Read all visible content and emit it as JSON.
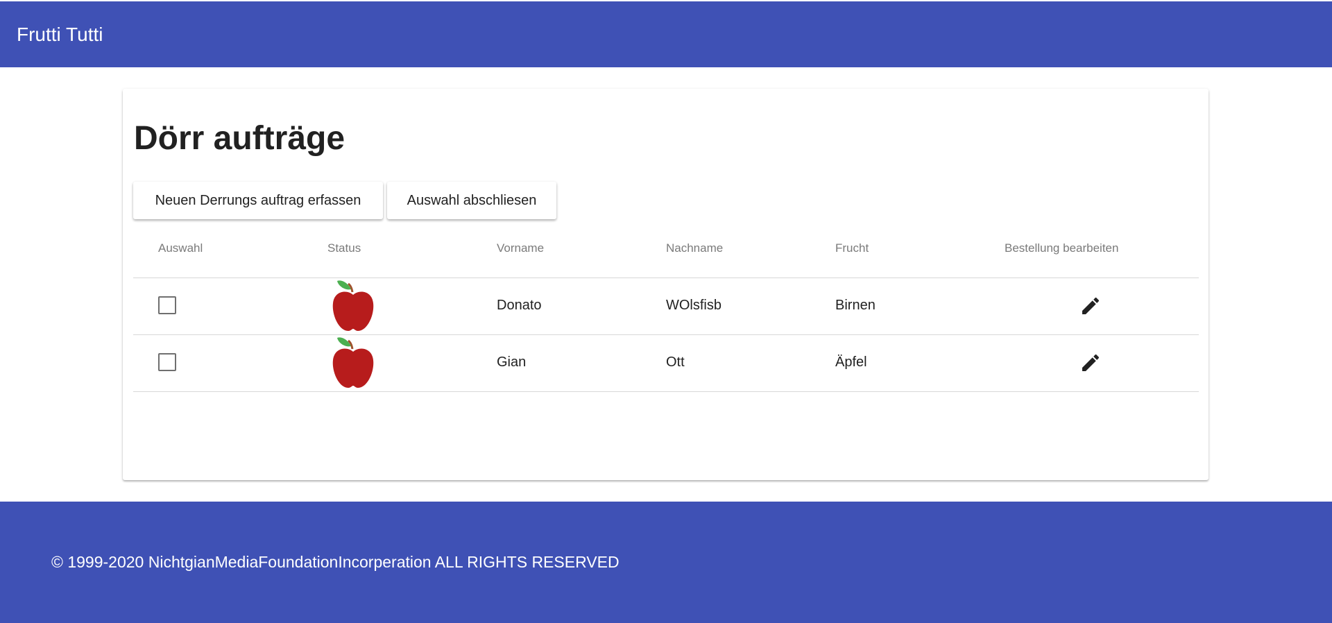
{
  "app": {
    "title": "Frutti Tutti",
    "brand_color": "#3f51b5"
  },
  "page": {
    "title": "Dörr aufträge"
  },
  "actions": {
    "new_order_label": "Neuen Derrungs auftrag erfassen",
    "close_selection_label": "Auswahl abschliesen"
  },
  "table": {
    "columns": [
      "Auswahl",
      "Status",
      "Vorname",
      "Nachname",
      "Frucht",
      "Bestellung bearbeiten"
    ],
    "rows": [
      {
        "selected": false,
        "status_icon": "apple-icon",
        "vorname": "Donato",
        "nachname": "WOlsfisb",
        "frucht": "Birnen",
        "edit_icon": "pencil-icon"
      },
      {
        "selected": false,
        "status_icon": "apple-icon",
        "vorname": "Gian",
        "nachname": "Ott",
        "frucht": "Äpfel",
        "edit_icon": "pencil-icon"
      }
    ]
  },
  "footer": {
    "copyright": "© 1999-2020 NichtgianMediaFoundationIncorperation ALL RIGHTS RESERVED"
  }
}
